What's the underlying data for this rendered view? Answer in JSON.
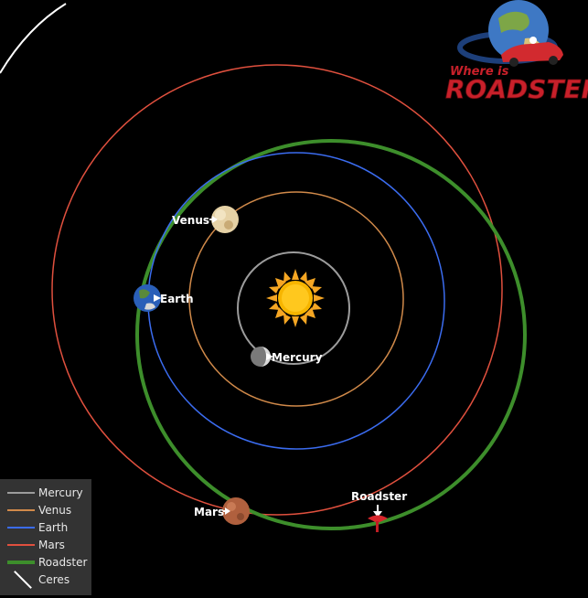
{
  "logo": {
    "line1": "Where is",
    "line2": "ROADSTER?"
  },
  "bodies": {
    "mercury": {
      "label": "Mercury",
      "color": "#9c9c9c"
    },
    "venus": {
      "label": "Venus",
      "color": "#d18a4a"
    },
    "earth": {
      "label": "Earth",
      "color": "#3b6cf0"
    },
    "mars": {
      "label": "Mars",
      "color": "#e0503e"
    },
    "roadster": {
      "label": "Roadster",
      "color": "#3d8e2b"
    }
  },
  "legend": {
    "items": [
      {
        "label": "Mercury",
        "color": "#9c9c9c",
        "style": "line"
      },
      {
        "label": "Venus",
        "color": "#d18a4a",
        "style": "line"
      },
      {
        "label": "Earth",
        "color": "#3b6cf0",
        "style": "line"
      },
      {
        "label": "Mars",
        "color": "#e0503e",
        "style": "line"
      },
      {
        "label": "Roadster",
        "color": "#3d8e2b",
        "style": "thick"
      },
      {
        "label": "Ceres",
        "color": "#ffffff",
        "style": "diagonal"
      }
    ]
  },
  "icons": {
    "sun": "sun-icon",
    "roadster_marker": "car-marker-icon"
  }
}
